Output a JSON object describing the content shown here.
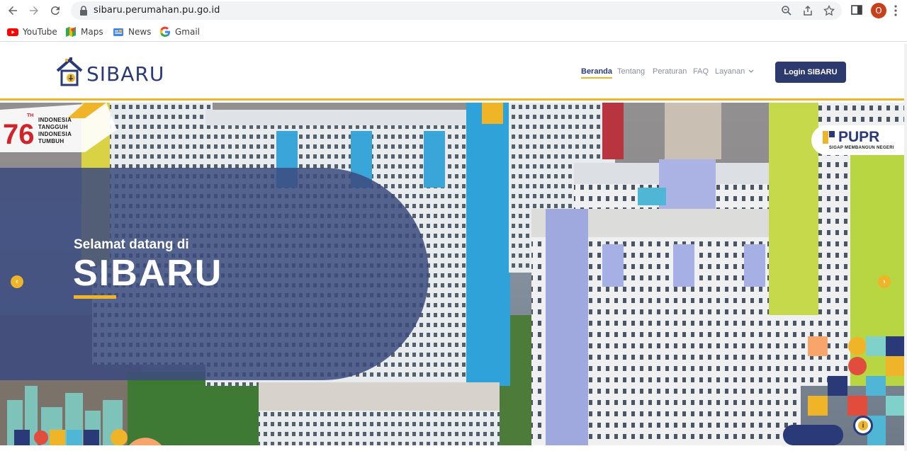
{
  "browser": {
    "url": "sibaru.perumahan.pu.go.id",
    "profile_initial": "O",
    "bookmarks": [
      {
        "label": "YouTube",
        "icon": "youtube-icon"
      },
      {
        "label": "Maps",
        "icon": "maps-icon"
      },
      {
        "label": "News",
        "icon": "news-icon"
      },
      {
        "label": "Gmail",
        "icon": "google-icon"
      }
    ]
  },
  "header": {
    "logo_text": "SIBARU",
    "nav": [
      {
        "label": "Beranda",
        "active": true
      },
      {
        "label": "Tentang",
        "active": false
      },
      {
        "label": "Peraturan",
        "active": false
      },
      {
        "label": "FAQ",
        "active": false
      },
      {
        "label": "Layanan",
        "active": false
      }
    ],
    "login_label": "Login SIBARU"
  },
  "hero": {
    "welcome_small": "Selamat datang di",
    "welcome_big": "SIBARU",
    "anniversary_th": "TH",
    "anniversary_lines": [
      "INDONESIA",
      "TANGGUH",
      "INDONESIA",
      "TUMBUH"
    ],
    "pupr_logo": "PUPR",
    "pupr_tagline": "SIGAP MEMBANGUN NEGERI",
    "prev_arrow": "‹",
    "next_arrow": "›"
  },
  "colors": {
    "brand_navy": "#2d3a6d",
    "accent_yellow": "#f0b429",
    "panel_overlay": "#3b4a7e"
  }
}
